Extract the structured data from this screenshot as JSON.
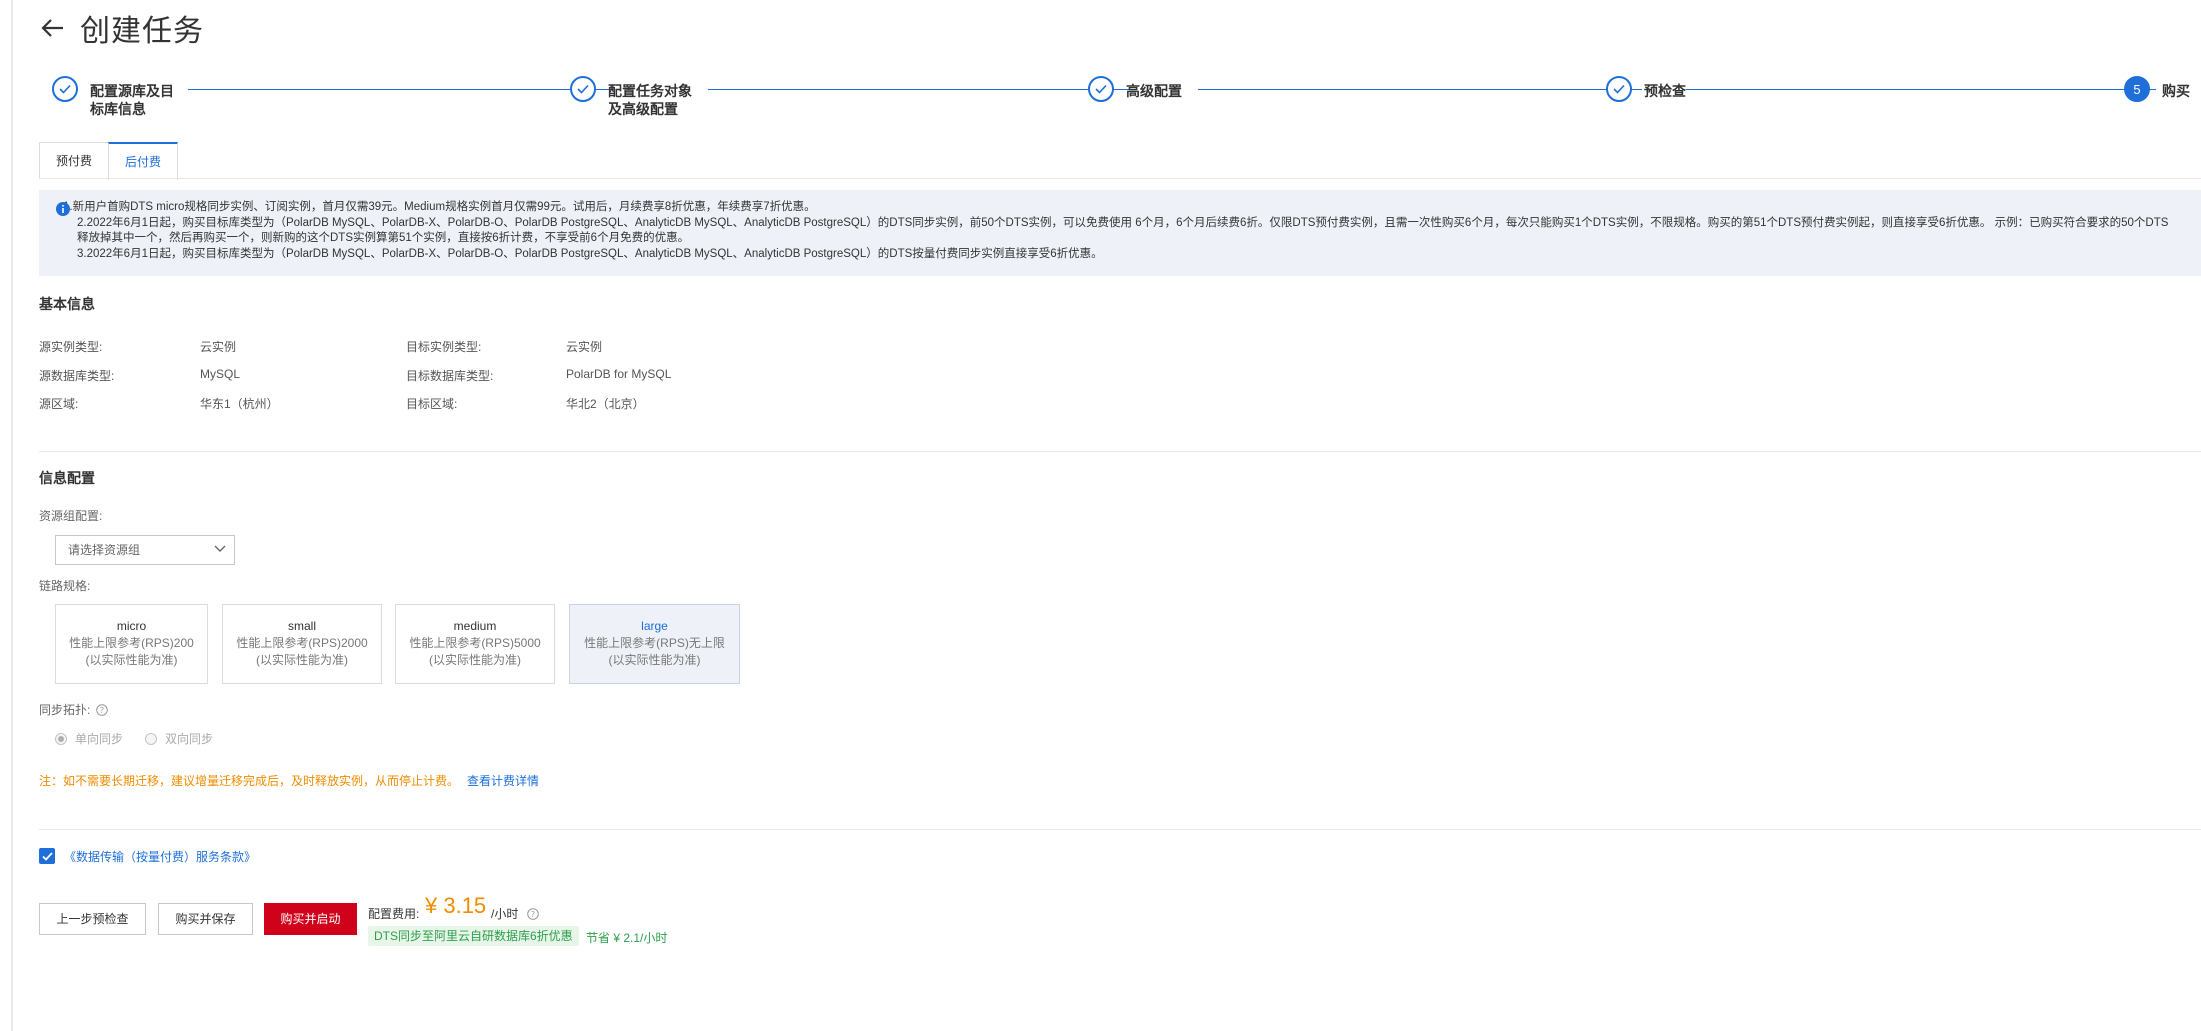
{
  "header": {
    "title": "创建任务"
  },
  "steps": [
    {
      "line1": "配置源库及目",
      "line2": "标库信息",
      "state": "done"
    },
    {
      "line1": "配置任务对象",
      "line2": "及高级配置",
      "state": "done"
    },
    {
      "line1": "高级配置",
      "line2": "",
      "state": "done"
    },
    {
      "line1": "预检查",
      "line2": "",
      "state": "done"
    },
    {
      "number": "5",
      "line1": "购买",
      "line2": "",
      "state": "active"
    }
  ],
  "tabs": [
    {
      "label": "预付费",
      "active": false
    },
    {
      "label": "后付费",
      "active": true
    }
  ],
  "notice": {
    "lines": [
      "1.新用户首购DTS micro规格同步实例、订阅实例，首月仅需39元。Medium规格实例首月仅需99元。试用后，月续费享8折优惠，年续费享7折优惠。",
      "2.2022年6月1日起，购买目标库类型为（PolarDB MySQL、PolarDB-X、PolarDB-O、PolarDB PostgreSQL、AnalyticDB MySQL、AnalyticDB PostgreSQL）的DTS同步实例，前50个DTS实例，可以免费使用 6个月，6个月后续费6折。仅限DTS预付费实例，且需一次性购买6个月，每次只能购买1个DTS实例，不限规格。购买的第51个DTS预付费实例起，则直接享受6折优惠。 示例：已购买符合要求的50个DTS",
      "释放掉其中一个，然后再购买一个，则新购的这个DTS实例算第51个实例，直接按6折计费，不享受前6个月免费的优惠。",
      "3.2022年6月1日起，购买目标库类型为（PolarDB MySQL、PolarDB-X、PolarDB-O、PolarDB PostgreSQL、AnalyticDB MySQL、AnalyticDB PostgreSQL）的DTS按量付费同步实例直接享受6折优惠。"
    ]
  },
  "basic_info": {
    "title": "基本信息",
    "rows": [
      {
        "label": "源实例类型:",
        "value": "云实例",
        "label2": "目标实例类型:",
        "value2": "云实例"
      },
      {
        "label": "源数据库类型:",
        "value": "MySQL",
        "label2": "目标数据库类型:",
        "value2": "PolarDB for MySQL"
      },
      {
        "label": "源区域:",
        "value": "华东1（杭州）",
        "label2": "目标区域:",
        "value2": "华北2（北京）"
      }
    ]
  },
  "config": {
    "title": "信息配置",
    "resource_group_label": "资源组配置:",
    "resource_group_placeholder": "请选择资源组",
    "spec_label": "链路规格:",
    "specs": [
      {
        "name": "micro",
        "line1": "性能上限参考(RPS)200",
        "line2": "(以实际性能为准)",
        "active": false
      },
      {
        "name": "small",
        "line1": "性能上限参考(RPS)2000",
        "line2": "(以实际性能为准)",
        "active": false
      },
      {
        "name": "medium",
        "line1": "性能上限参考(RPS)5000",
        "line2": "(以实际性能为准)",
        "active": false
      },
      {
        "name": "large",
        "line1": "性能上限参考(RPS)无上限",
        "line2": "(以实际性能为准)",
        "active": true
      }
    ],
    "sync_label": "同步拓扑:",
    "sync_options": [
      {
        "label": "单向同步",
        "selected": true
      },
      {
        "label": "双向同步",
        "selected": false
      }
    ],
    "note": "注：如不需要长期迁移，建议增量迁移完成后，及时释放实例，从而停止计费。",
    "note_link": "查看计费详情"
  },
  "terms": {
    "checked": true,
    "label": "《数据传输（按量付费）服务条款》"
  },
  "footer": {
    "prev_button": "上一步预检查",
    "save_button": "购买并保存",
    "start_button": "购买并启动",
    "price_label": "配置费用:",
    "price_value": "¥ 3.15",
    "price_unit": "/小时",
    "promo_tag": "DTS同步至阿里云自研数据库6折优惠",
    "save_text": "节省 ¥ 2.1/小时"
  },
  "colors": {
    "accent": "#1e6fd9",
    "danger": "#d0021b",
    "price": "#f08c00",
    "success": "#2e9e4d"
  }
}
